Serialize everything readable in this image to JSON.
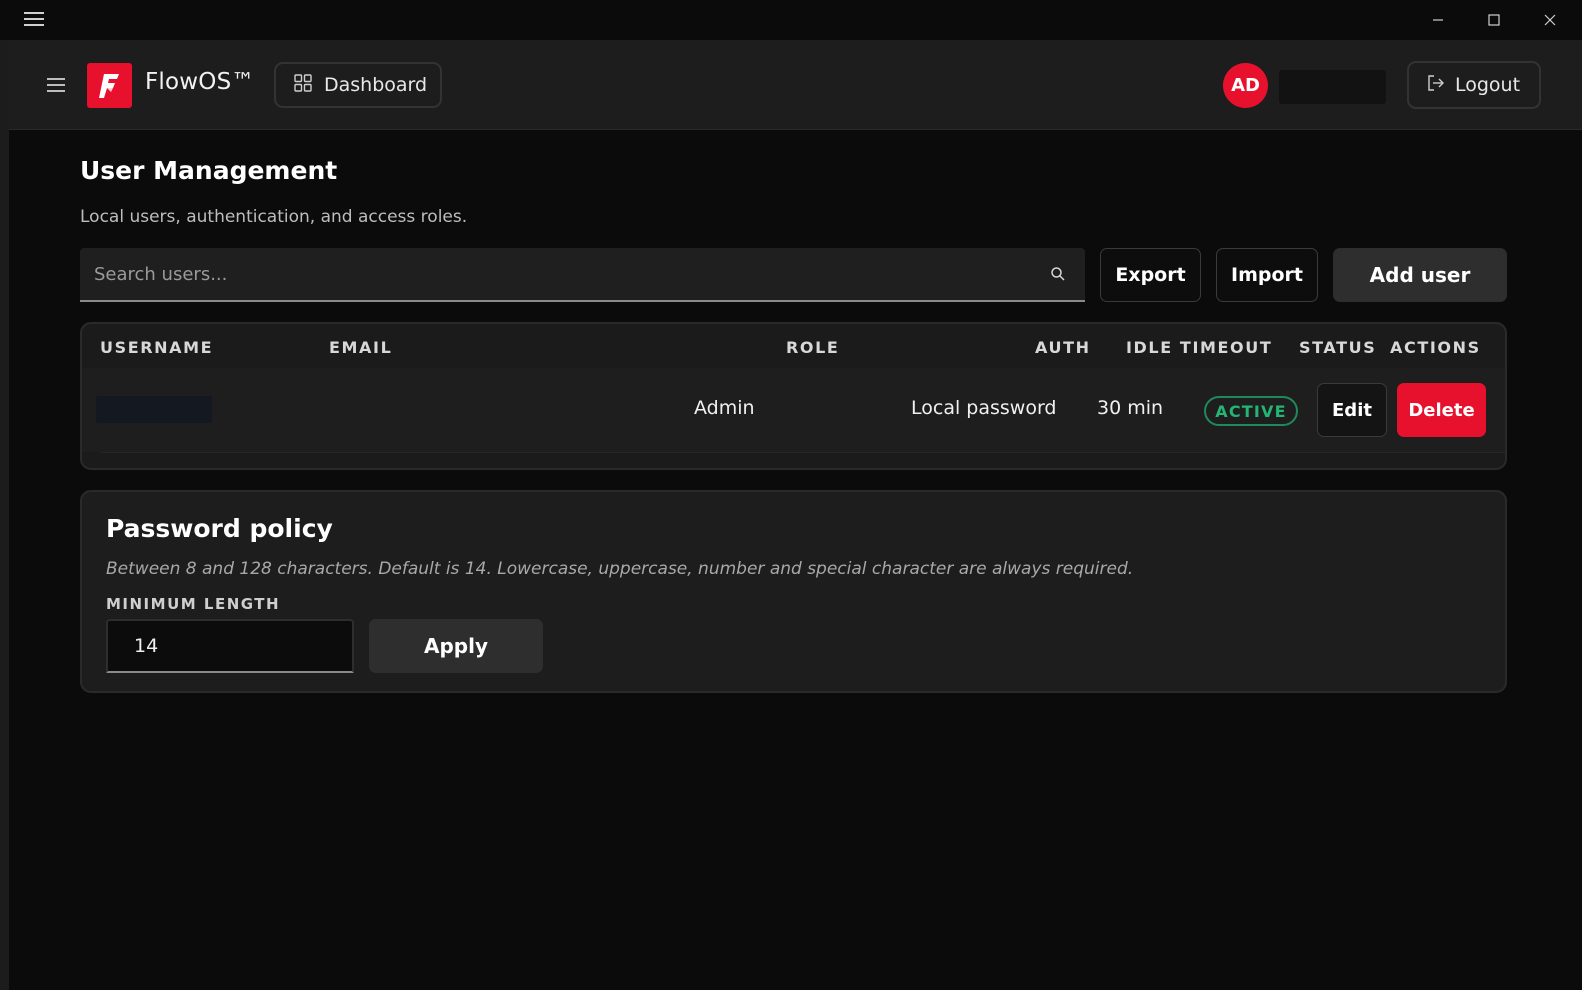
{
  "app": {
    "brand": "FlowOS™",
    "brand_color": "#e8112d"
  },
  "titlebar": {
    "menu_icon": "hamburger-icon",
    "minimize_icon": "minimize-icon",
    "maximize_icon": "maximize-icon",
    "close_icon": "close-icon"
  },
  "header": {
    "menu_icon": "hamburger-icon",
    "dashboard_label": "Dashboard",
    "dashboard_icon": "grid-icon",
    "avatar_initials": "AD",
    "logout_label": "Logout",
    "logout_icon": "logout-icon"
  },
  "page": {
    "title": "User Management",
    "subtitle": "Local users, authentication, and access roles."
  },
  "search": {
    "placeholder": "Search users...",
    "value": "",
    "icon": "search-icon"
  },
  "actions": {
    "export_label": "Export",
    "import_label": "Import",
    "add_user_label": "Add user"
  },
  "table": {
    "columns": [
      "USERNAME",
      "EMAIL",
      "ROLE",
      "AUTH",
      "IDLE TIMEOUT",
      "STATUS",
      "ACTIONS"
    ],
    "rows": [
      {
        "username": "",
        "email": "",
        "role": "Admin",
        "auth": "Local password",
        "idle_timeout": "30 min",
        "status": "ACTIVE",
        "edit_label": "Edit",
        "delete_label": "Delete"
      }
    ]
  },
  "password_policy": {
    "title": "Password policy",
    "description": "Between 8 and 128 characters. Default is 14. Lowercase, uppercase, number and special character are always required.",
    "min_length_label": "MINIMUM LENGTH",
    "min_length_value": "14",
    "apply_label": "Apply"
  },
  "colors": {
    "accent": "#e8112d",
    "status_active": "#23b574",
    "background": "#0b0b0b",
    "surface": "#1d1d1d"
  }
}
